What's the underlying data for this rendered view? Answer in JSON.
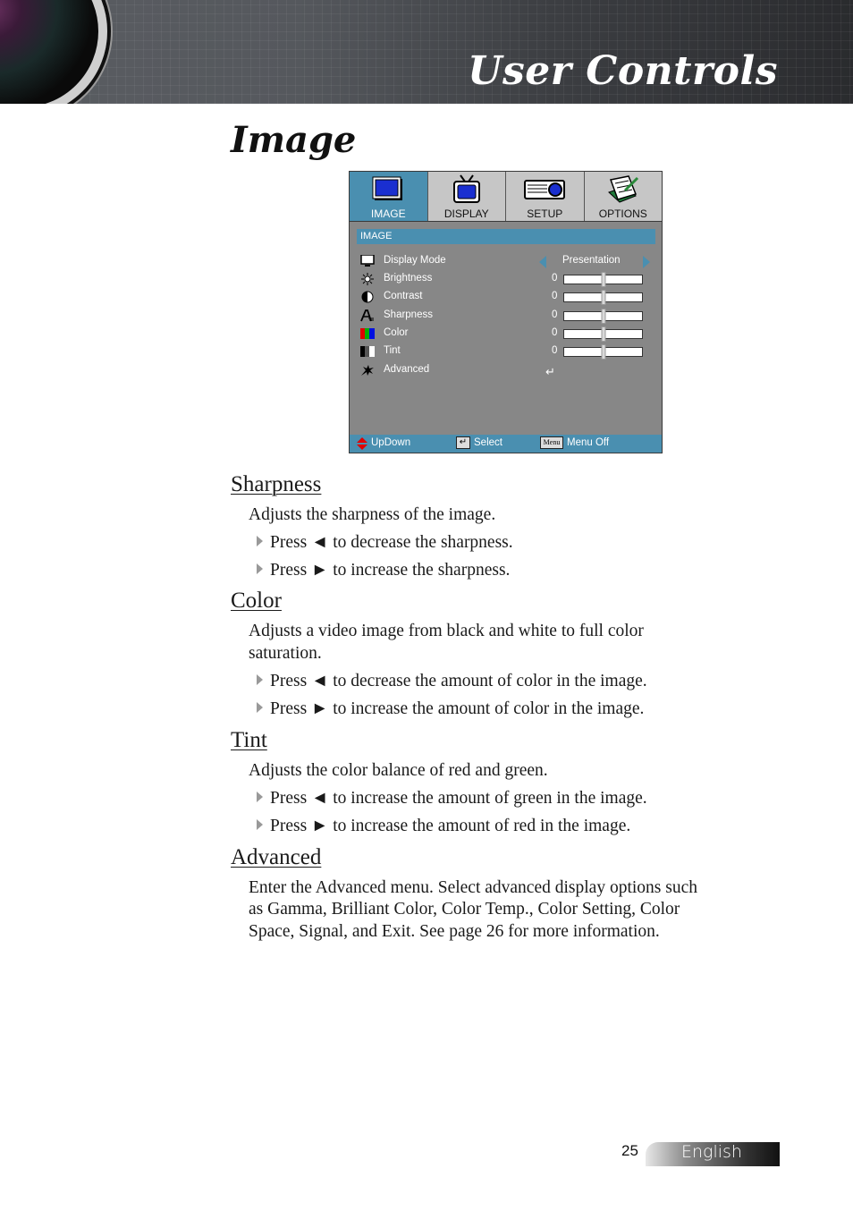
{
  "header": {
    "title": "User Controls"
  },
  "page_title": "Image",
  "osd": {
    "tabs": [
      {
        "label": "IMAGE",
        "icon": "monitor-icon",
        "active": true
      },
      {
        "label": "DISPLAY",
        "icon": "tv-icon",
        "active": false
      },
      {
        "label": "SETUP",
        "icon": "projector-icon",
        "active": false
      },
      {
        "label": "OPTIONS",
        "icon": "notepad-icon",
        "active": false
      }
    ],
    "section_title": "IMAGE",
    "items": [
      {
        "label": "Display Mode",
        "icon": "display-mode-icon",
        "value": "Presentation"
      },
      {
        "label": "Brightness",
        "icon": "brightness-icon",
        "value": "0",
        "level": 0.5
      },
      {
        "label": "Contrast",
        "icon": "contrast-icon",
        "value": "0",
        "level": 0.5
      },
      {
        "label": "Sharpness",
        "icon": "sharpness-icon",
        "value": "0",
        "level": 0.5
      },
      {
        "label": "Color",
        "icon": "color-icon",
        "value": "0",
        "level": 0.5
      },
      {
        "label": "Tint",
        "icon": "tint-icon",
        "value": "0",
        "level": 0.5
      },
      {
        "label": "Advanced",
        "icon": "advanced-icon",
        "value": "↵"
      }
    ],
    "footer": {
      "updown": "UpDown",
      "select": "Select",
      "menu_key": "Menu",
      "menu_off": "Menu Off"
    },
    "colors": {
      "accent": "#4a8fb0",
      "panel": "#878787",
      "tab": "#c6c6c6"
    }
  },
  "sections": {
    "sharpness": {
      "heading": "Sharpness",
      "desc": "Adjusts the sharpness of the image.",
      "bullets": [
        "Press ◄ to decrease the sharpness.",
        "Press ► to increase the sharpness."
      ]
    },
    "color": {
      "heading": "Color",
      "desc_line1": "Adjusts a video image from black and white to full color",
      "desc_line2": "saturation.",
      "bullets": [
        "Press ◄ to decrease the amount of color in the image.",
        "Press ► to increase the amount of color in the image."
      ]
    },
    "tint": {
      "heading": "Tint",
      "desc": "Adjusts the color balance of red and green.",
      "bullets": [
        "Press ◄ to increase the amount of green in the image.",
        "Press ► to increase the amount of red in the image."
      ]
    },
    "advanced": {
      "heading": "Advanced",
      "desc_line1": "Enter the Advanced menu. Select advanced display options such",
      "desc_line2": "as Gamma, Brilliant Color, Color Temp., Color Setting, Color",
      "desc_line3": "Space, Signal, and Exit. See page 26 for more information."
    }
  },
  "footer": {
    "page_number": "25",
    "language": "English"
  }
}
